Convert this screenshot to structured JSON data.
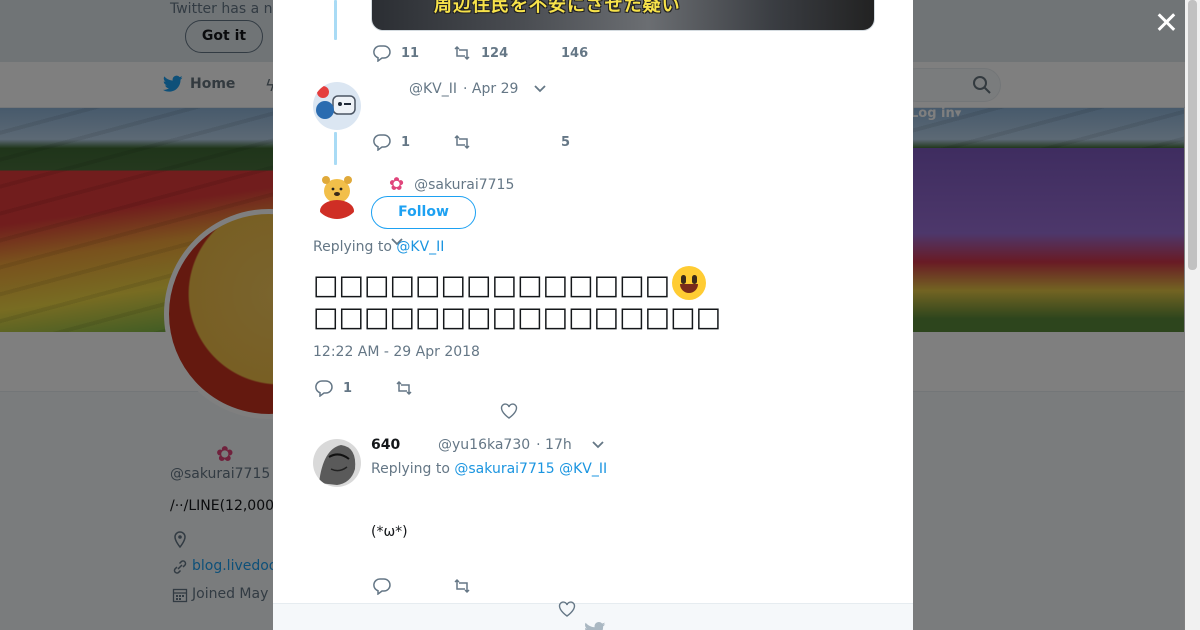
{
  "background": {
    "notice": {
      "text": "Twitter has a n",
      "button_label": "Got it"
    },
    "nav": {
      "home_label": "Home",
      "login_label": "Log in"
    },
    "profile": {
      "name": "ㅤㅤ",
      "handle": "@sakurai7715",
      "bio": "/··/LINE(12,000",
      "link": "blog.livedoo",
      "joined": "Joined May"
    }
  },
  "thread": {
    "image_caption": "周辺住民を不安にさせた疑い",
    "tweet1_actions": {
      "reply_count": "11",
      "retweet_count": "124",
      "like_count": "146"
    },
    "tweet2": {
      "handle": "@KV_II",
      "date": "· Apr 29",
      "reply_count": "1",
      "like_count": "5"
    }
  },
  "main_tweet": {
    "handle": "@sakurai7715",
    "follow_label": "Follow",
    "replying_prefix": "Replying to",
    "replying_to": "@KV_II",
    "text_line1": "□□□□□□□□□□□□□□",
    "text_line2": "□□□□□□□□□□□□□□□□",
    "timestamp": "12:22 AM - 29 Apr 2018",
    "reply_count": "1"
  },
  "reply_tweet": {
    "name": "640",
    "handle": "@yu16ka730",
    "time": "· 17h",
    "replying_prefix": "Replying to",
    "replying_to_1": "@sakurai7715",
    "replying_to_2": "@KV_II",
    "body": "(*ω*)"
  },
  "colors": {
    "accent": "#1da1f2",
    "thread_line": "#a9dbf5",
    "muted": "#657786"
  }
}
